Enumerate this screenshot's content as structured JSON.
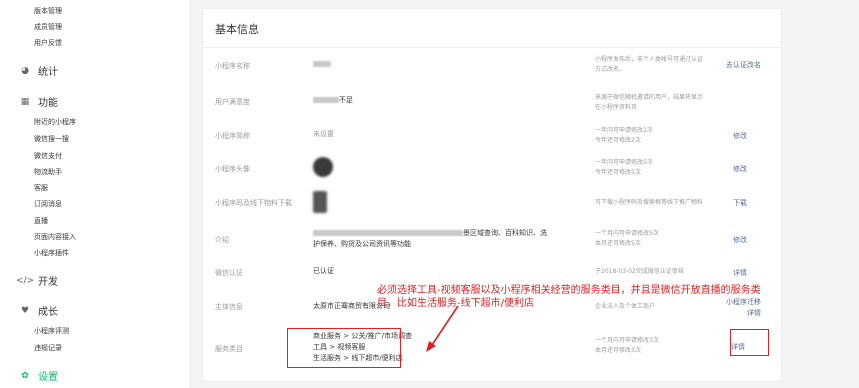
{
  "sidebar": {
    "top_items": [
      "版本管理",
      "成员管理",
      "用户反馈"
    ],
    "stats": {
      "label": "统计",
      "icon": "pie-chart-icon"
    },
    "features": {
      "label": "功能",
      "icon": "grid-icon",
      "items": [
        "附近的小程序",
        "微信搜一搜",
        "微信支付",
        "物流助手",
        "客服",
        "订阅消息",
        "直播",
        "页面内容接入",
        "小程序插件"
      ]
    },
    "dev": {
      "label": "开发",
      "icon": "code-icon"
    },
    "growth": {
      "label": "成长",
      "icon": "heart-icon",
      "items": [
        "小程序评测",
        "违规记录"
      ]
    },
    "settings": {
      "label": "设置",
      "icon": "gear-icon",
      "active_color": "#07c160"
    }
  },
  "main": {
    "title": "基本信息",
    "rows": [
      {
        "label": "小程序名称",
        "desc": [
          "小程序发布后，非个人类帐号可通过认证",
          "方式改名。"
        ],
        "action": "去认证改名"
      },
      {
        "label": "用户满意度",
        "value_suffix": "不足",
        "desc": [
          "来源于微信随机邀请的用户，结果将显示",
          "在小程序资料页"
        ],
        "action": ""
      },
      {
        "label": "小程序简称",
        "value": "未设置",
        "desc": [
          "一年内可申请修改2次",
          "今年还可修改2次"
        ],
        "action": "修改"
      },
      {
        "label": "小程序头像",
        "desc": [
          "一年内可申请修改5次",
          "今年还可修改5次"
        ],
        "action": "修改"
      },
      {
        "label": "小程序码及线下物料下载",
        "desc": [
          "可下载小程序码及搜索框等线下推广物料"
        ],
        "action": "下载"
      },
      {
        "label": "介绍",
        "value_lines": [
          "景区域查询、百科知识、洗",
          "护保养、购货及公司资讯等功能"
        ],
        "desc": [
          "一个月内可申请修改5次",
          "本月还可修改5次"
        ],
        "action": "修改"
      },
      {
        "label": "微信认证",
        "value": "已认证",
        "desc": [
          "于2018-03-02完成微信认证审核"
        ],
        "action": "详情"
      },
      {
        "label": "主体信息",
        "value": "太原市正骞商贸有限公司",
        "desc": [
          "企业法人及个体工商户"
        ],
        "action_lines": [
          "小程序迁移",
          "详情"
        ]
      },
      {
        "label": "服务类目",
        "value_lines": [
          "商业服务 > 公关/推广/市场调查",
          "工具 > 视频客服",
          "生活服务 > 线下超市/便利店"
        ],
        "desc": [
          "一个月内可申请修改3次",
          "本月还可修改3次"
        ],
        "action": "详情"
      }
    ]
  },
  "annotation": {
    "text": "必须选择工具-视频客服以及小程序相关经营的服务类目，并且是微信开放直播的服务类目，比如生活服务-线下超市/便利店",
    "color": "#e02020"
  },
  "colors": {
    "link": "#576b95",
    "accent": "#07c160"
  }
}
